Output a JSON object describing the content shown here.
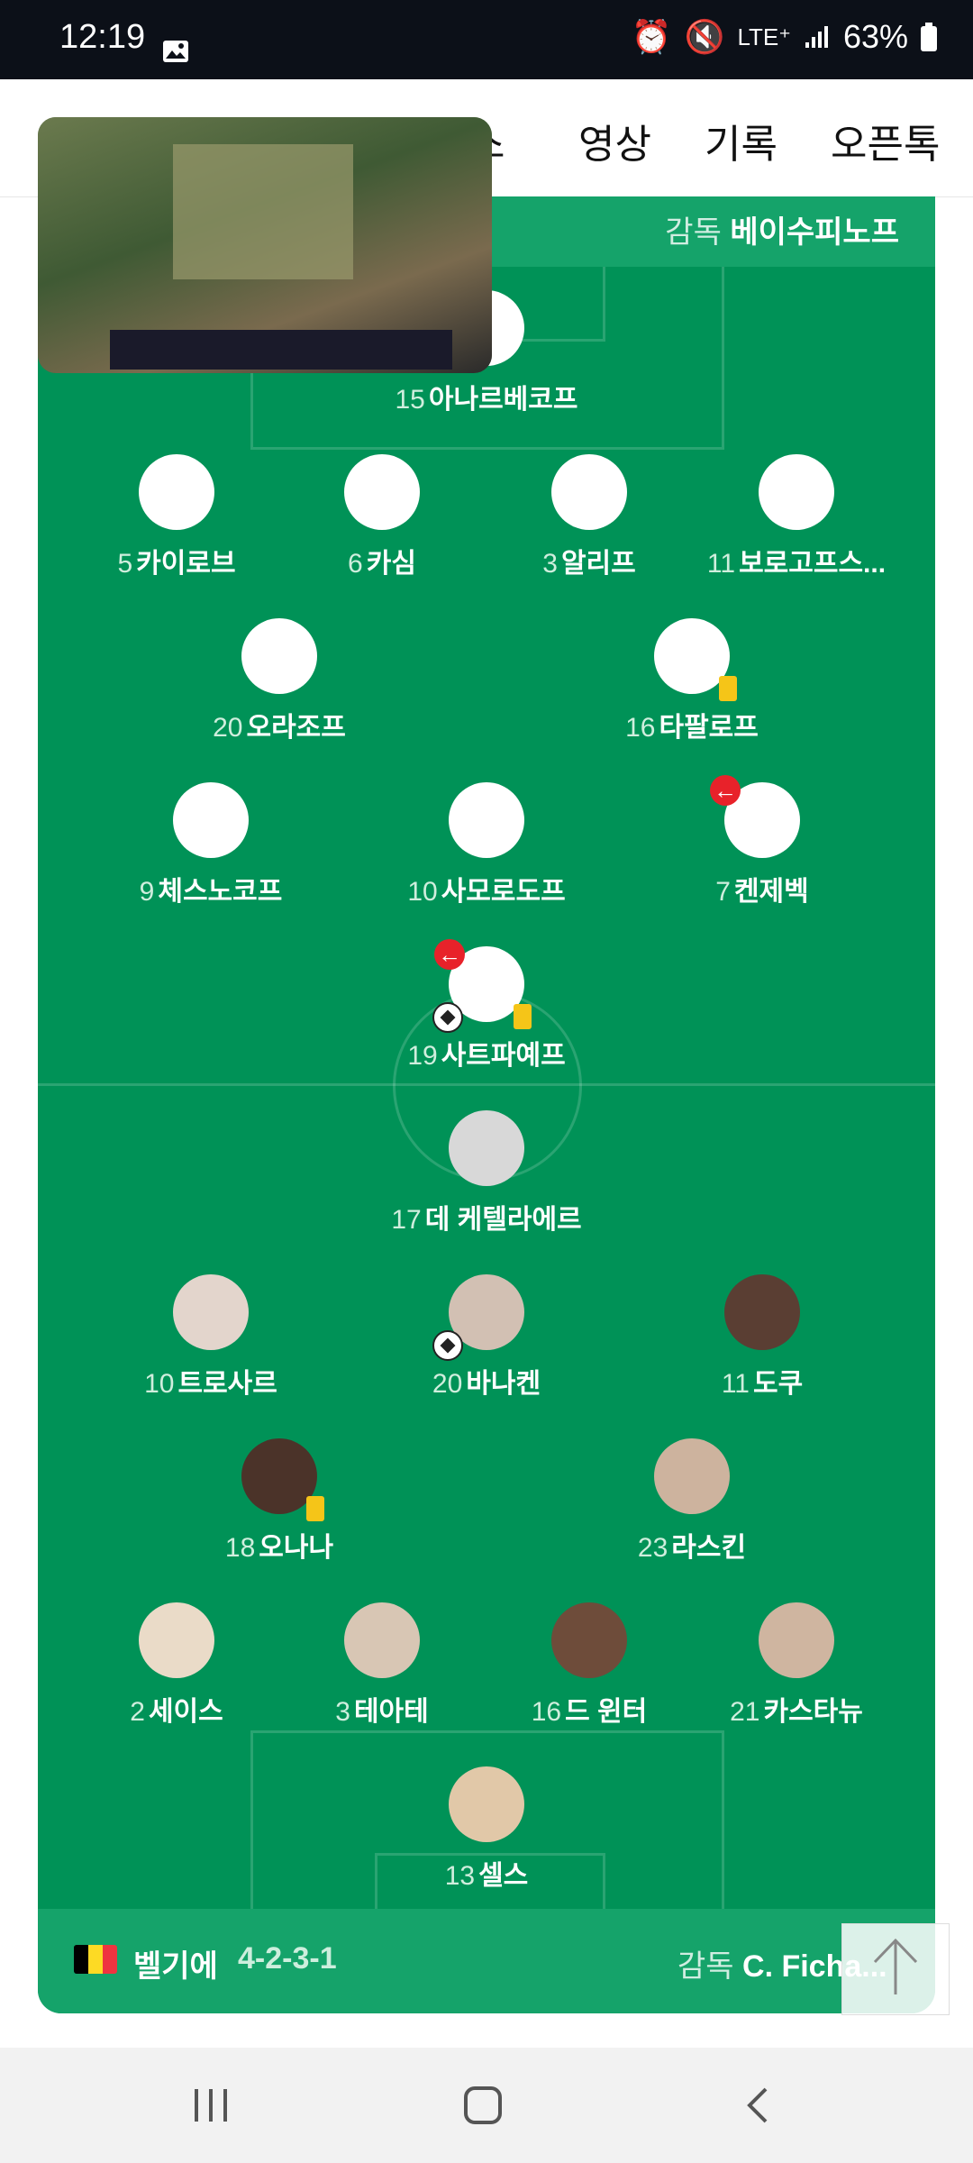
{
  "status": {
    "time": "12:19",
    "network": "LTE⁺",
    "battery": "63%"
  },
  "nav": {
    "tabs": [
      "스",
      "영상",
      "기록",
      "오픈톡"
    ]
  },
  "top_team": {
    "coach_label": "감독",
    "coach_name": "베이수피노프"
  },
  "bottom_team": {
    "name": "벨기에",
    "formation": "4-2-3-1",
    "coach_label": "감독",
    "coach_name": "C. Ficha..."
  },
  "players_top": [
    {
      "num": "15",
      "name": "아나르베코프"
    },
    {
      "num": "5",
      "name": "카이로브"
    },
    {
      "num": "6",
      "name": "카심"
    },
    {
      "num": "3",
      "name": "알리프"
    },
    {
      "num": "11",
      "name": "보로고프스..."
    },
    {
      "num": "20",
      "name": "오라조프"
    },
    {
      "num": "16",
      "name": "타팔로프"
    },
    {
      "num": "9",
      "name": "체스노코프"
    },
    {
      "num": "10",
      "name": "사모로도프"
    },
    {
      "num": "7",
      "name": "켄제벡"
    },
    {
      "num": "19",
      "name": "사트파예프"
    }
  ],
  "players_bottom": [
    {
      "num": "17",
      "name": "데 케텔라에르"
    },
    {
      "num": "10",
      "name": "트로사르"
    },
    {
      "num": "20",
      "name": "바나켄"
    },
    {
      "num": "11",
      "name": "도쿠"
    },
    {
      "num": "18",
      "name": "오나나"
    },
    {
      "num": "23",
      "name": "라스킨"
    },
    {
      "num": "2",
      "name": "세이스"
    },
    {
      "num": "3",
      "name": "테아테"
    },
    {
      "num": "16",
      "name": "드 윈터"
    },
    {
      "num": "21",
      "name": "카스타뉴"
    },
    {
      "num": "13",
      "name": "셀스"
    }
  ],
  "colors": {
    "pitch": "#009257",
    "band": "#15a36a",
    "yellow_card": "#f5c518",
    "sub_red": "#e8222a"
  },
  "icons": {
    "sub": "arrow-left-icon",
    "goal": "soccer-ball-icon",
    "card": "yellow-card-icon"
  }
}
